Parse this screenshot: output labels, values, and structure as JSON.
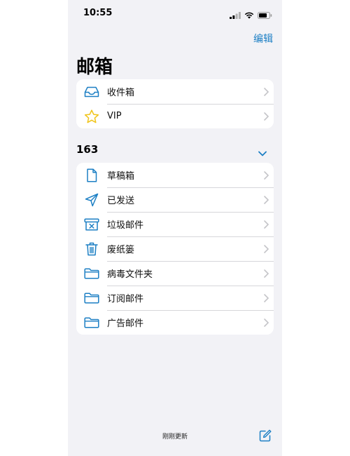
{
  "status_bar": {
    "time": "10:55"
  },
  "header": {
    "edit_label": "编辑",
    "title": "邮箱"
  },
  "mailboxes": [
    {
      "label": "收件箱",
      "icon": "inbox-icon"
    },
    {
      "label": "VIP",
      "icon": "star-icon"
    }
  ],
  "account": {
    "name": "163",
    "folders": [
      {
        "label": "草稿箱",
        "icon": "draft-document-icon"
      },
      {
        "label": "已发送",
        "icon": "paper-plane-icon"
      },
      {
        "label": "垃圾邮件",
        "icon": "junk-box-icon"
      },
      {
        "label": "废纸篓",
        "icon": "trash-icon"
      },
      {
        "label": "病毒文件夹",
        "icon": "folder-icon"
      },
      {
        "label": "订阅邮件",
        "icon": "folder-icon"
      },
      {
        "label": "广告邮件",
        "icon": "folder-icon"
      }
    ]
  },
  "footer": {
    "status_text": "刚刚更新"
  },
  "colors": {
    "accent": "#1c7fc4",
    "star": "#f0c419",
    "background": "#f2f2f6"
  }
}
